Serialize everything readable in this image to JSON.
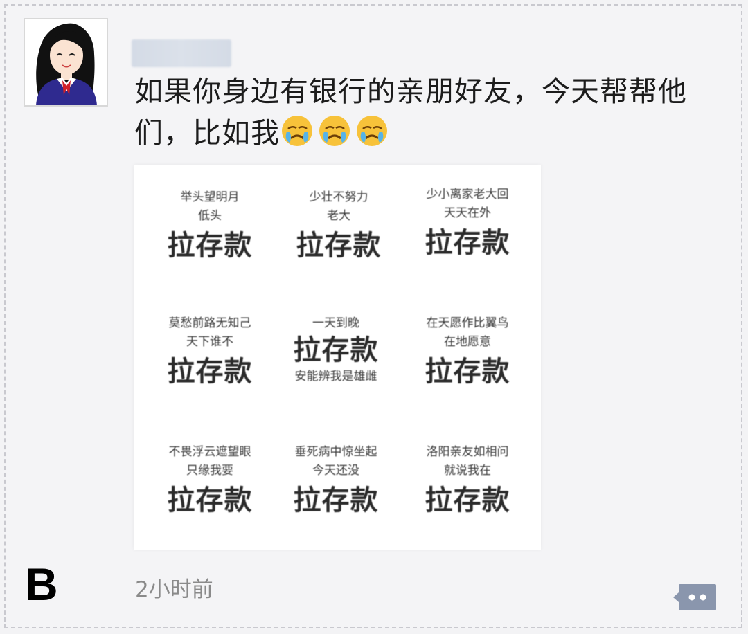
{
  "post": {
    "username_redacted": true,
    "text": "如果你身边有银行的亲朋好友，今天帮帮他们，比如我",
    "emojis": [
      "crying-emoji",
      "crying-emoji",
      "crying-emoji"
    ],
    "timestamp": "2小时前"
  },
  "image_grid": [
    {
      "lines": [
        "举头望明月",
        "低头"
      ],
      "main": "拉存款"
    },
    {
      "lines": [
        "少壮不努力",
        "老大"
      ],
      "main": "拉存款"
    },
    {
      "lines": [
        "少小离家老大回",
        "天天在外"
      ],
      "main": "拉存款"
    },
    {
      "lines": [
        "莫愁前路无知己",
        "天下谁不"
      ],
      "main": "拉存款"
    },
    {
      "lines": [
        "一天到晚"
      ],
      "main": "拉存款",
      "after": "安能辨我是雄雌"
    },
    {
      "lines": [
        "在天愿作比翼鸟",
        "在地愿意"
      ],
      "main": "拉存款"
    },
    {
      "lines": [
        "不畏浮云遮望眼",
        "只缘我要"
      ],
      "main": "拉存款"
    },
    {
      "lines": [
        "垂死病中惊坐起",
        "今天还没"
      ],
      "main": "拉存款"
    },
    {
      "lines": [
        "洛阳亲友如相问",
        "就说我在"
      ],
      "main": "拉存款"
    }
  ],
  "panel_label": "B",
  "colors": {
    "background": "#f4f4f6",
    "text": "#1c1c1c",
    "time": "#8a8a8a",
    "comment_button": "#8a96ad"
  }
}
